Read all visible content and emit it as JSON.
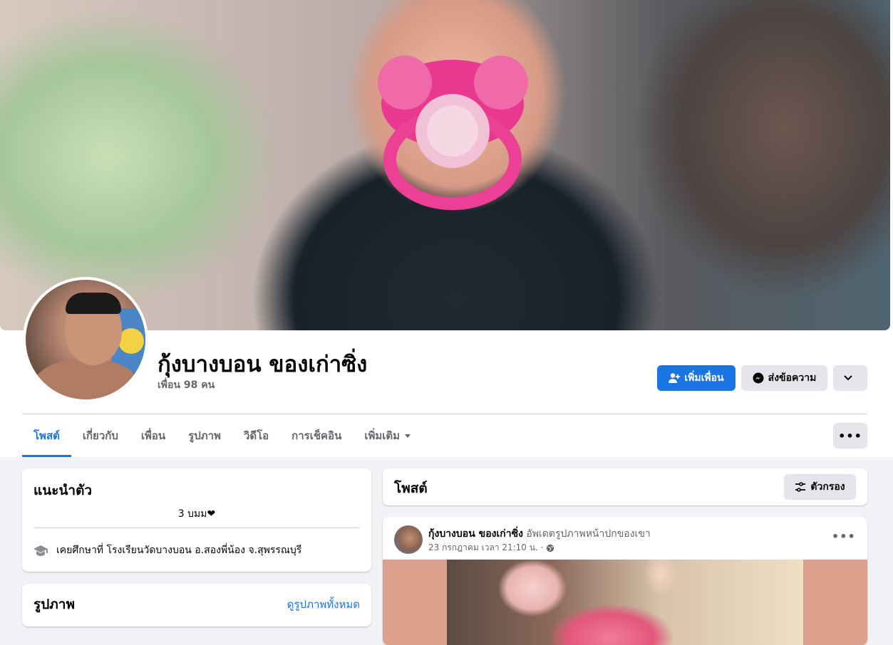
{
  "profile": {
    "name": "กุ้งบางบอน ของเก่าซิ่ง",
    "friends": "เพื่อน 98 คน"
  },
  "actions": {
    "add_friend": "เพิ่มเพื่อน",
    "message": "ส่งข้อความ"
  },
  "tabs": [
    {
      "label": "โพสต์",
      "active": true
    },
    {
      "label": "เกี่ยวกับ"
    },
    {
      "label": "เพื่อน"
    },
    {
      "label": "รูปภาพ"
    },
    {
      "label": "วิดีโอ"
    },
    {
      "label": "การเช็คอิน"
    },
    {
      "label": "เพิ่มเติม"
    }
  ],
  "intro": {
    "title": "แนะนำตัว",
    "bio": "3 บมม❤",
    "education_prefix": "เคยศึกษาที่",
    "education_school": "โรงเรียนวัดบางบอน อ.สองพี่น้อง จ.สุพรรณบุรี"
  },
  "photos": {
    "title": "รูปภาพ",
    "see_all": "ดูรูปภาพทั้งหมด"
  },
  "posts": {
    "title": "โพสต์",
    "filter": "ตัวกรอง"
  },
  "post": {
    "author": "กุ้งบางบอน ของเก่าซิ่ง",
    "action": "อัพเดตรูปภาพหน้าปกของเขา",
    "time": "23 กรกฎาคม เวลา 21:10 น. ·"
  },
  "colors": {
    "accent": "#1b74e4",
    "secondary_bg": "#e4e6eb",
    "page_bg": "#f0f2f5"
  }
}
